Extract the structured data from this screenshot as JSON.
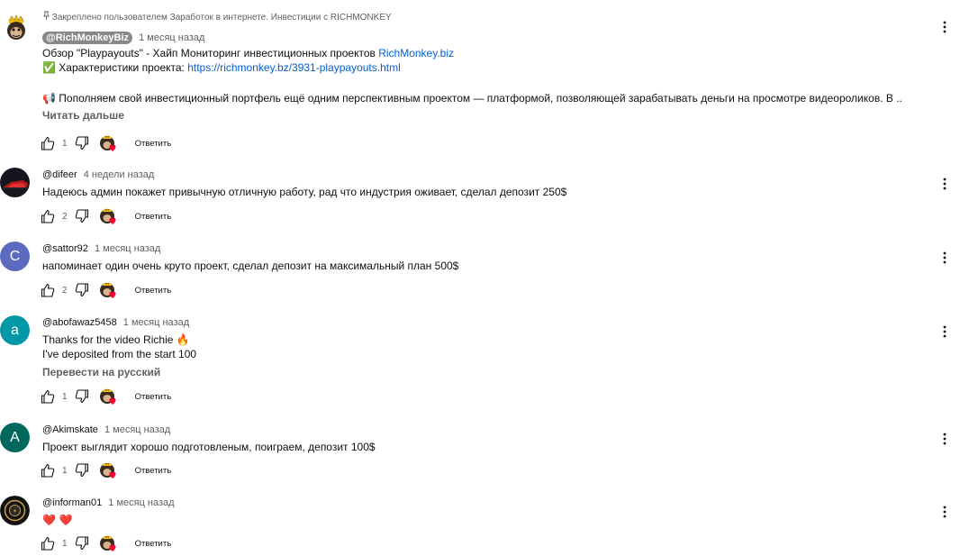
{
  "pinned": {
    "pin_label": "Закреплено пользователем Заработок в интернете. Инвестиции с RICHMONKEY",
    "author": "@RichMonkeyBiz",
    "time": "1 месяц назад",
    "line1_prefix": "Обзор \"Playpayouts\" - Хайп Мониторинг инвестиционных проектов ",
    "line1_link": "RichMonkey.biz",
    "line2_emoji": "✅",
    "line2_prefix": " Характеристики проекта: ",
    "line2_link": "https://richmonkey.bz/3931-playpayouts.html",
    "line3_emoji": "📢",
    "line3_text": " Пополняем свой инвестиционный портфель ещё одним перспективным проектом — платформой, позволяющей зарабатывать деньги на просмотре видеороликов. В ..",
    "read_more": "Читать дальше",
    "likes": "1",
    "reply": "Ответить"
  },
  "comments": [
    {
      "author": "@difeer",
      "time": "4 недели назад",
      "text": "Надеюсь админ покажет привычную отличную работу, рад что индустрия оживает, сделал депозит 250$",
      "likes": "2",
      "reply": "Ответить",
      "avatar_color": "#1a1a2a"
    },
    {
      "author": "@sattor92",
      "time": "1 месяц назад",
      "text": "напоминает один очень круто проект, сделал депозит на максимальный план 500$",
      "likes": "2",
      "reply": "Ответить",
      "avatar_letter": "С",
      "avatar_color": "#5c6bc0"
    },
    {
      "author": "@abofawaz5458",
      "time": "1 месяц назад",
      "line1": "Thanks for the video Richie ",
      "line1_emoji": "🔥",
      "line2": "I've deposited from the start 100",
      "translate": "Перевести на русский",
      "likes": "1",
      "reply": "Ответить",
      "avatar_letter": "a",
      "avatar_color": "#0097a7"
    },
    {
      "author": "@Akimskate",
      "time": "1 месяц назад",
      "text": "Проект выглядит хорошо подготовленым, поиграем, депозит 100$",
      "likes": "1",
      "reply": "Ответить",
      "avatar_letter": "A",
      "avatar_color": "#00695c"
    },
    {
      "author": "@informan01",
      "time": "1 месяц назад",
      "text": "❤️ ❤️",
      "likes": "1",
      "reply": "Ответить",
      "avatar_color": "#111111"
    }
  ],
  "colors": {
    "link": "#065fd4",
    "muted": "#606060",
    "heart": "#ff0033"
  },
  "icons": [
    "pin-icon",
    "like-icon",
    "dislike-icon",
    "creator-heart-icon",
    "more-vert-icon"
  ]
}
